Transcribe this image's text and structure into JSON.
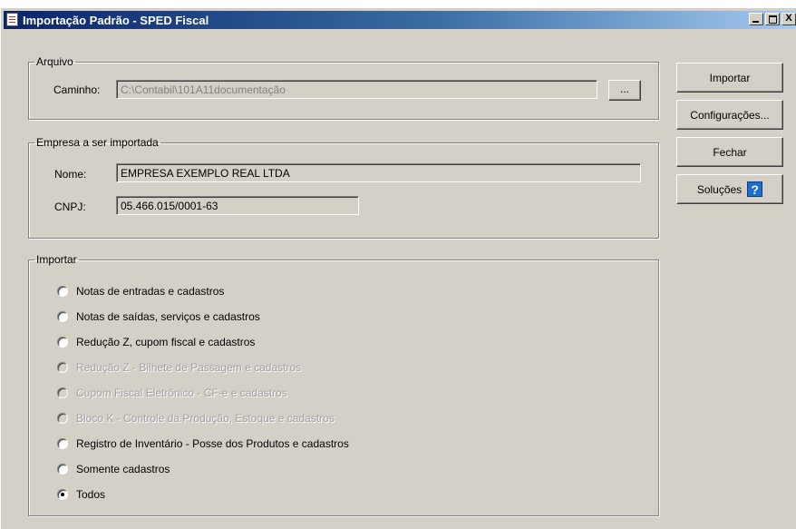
{
  "window": {
    "title": "Importação Padrão - SPED Fiscal",
    "minimize_label": "_",
    "maximize_label": "",
    "close_label": "X"
  },
  "arquivo": {
    "legend": "Arquivo",
    "caminho_label": "Caminho:",
    "caminho_value": "C:\\Contabil\\101A11documentação",
    "browse_label": "..."
  },
  "empresa": {
    "legend": "Empresa a ser importada",
    "nome_label": "Nome:",
    "nome_value": "EMPRESA EXEMPLO REAL LTDA",
    "cnpj_label": "CNPJ:",
    "cnpj_value": "05.466.015/0001-63"
  },
  "importar": {
    "legend": "Importar",
    "options": [
      {
        "label": "Notas de entradas e cadastros",
        "enabled": true,
        "checked": false
      },
      {
        "label": "Notas de saídas, serviços e cadastros",
        "enabled": true,
        "checked": false
      },
      {
        "label": "Redução Z, cupom fiscal e cadastros",
        "enabled": true,
        "checked": false
      },
      {
        "label": "Redução Z - Bilhete de Passagem e cadastros",
        "enabled": false,
        "checked": false
      },
      {
        "label": "Cupom Fiscal Eletrônico - CF-e e cadastros",
        "enabled": false,
        "checked": false
      },
      {
        "label": "Bloco K - Controle da Produção, Estoque e cadastros",
        "enabled": false,
        "checked": false
      },
      {
        "label": "Registro de Inventário - Posse dos Produtos e cadastros",
        "enabled": true,
        "checked": false
      },
      {
        "label": "Somente cadastros",
        "enabled": true,
        "checked": false
      },
      {
        "label": "Todos",
        "enabled": true,
        "checked": true
      }
    ]
  },
  "actions": {
    "importar_label": "Importar",
    "configuracoes_label": "Configurações...",
    "fechar_label": "Fechar",
    "solucoes_label": "Soluções",
    "help_glyph": "?"
  }
}
